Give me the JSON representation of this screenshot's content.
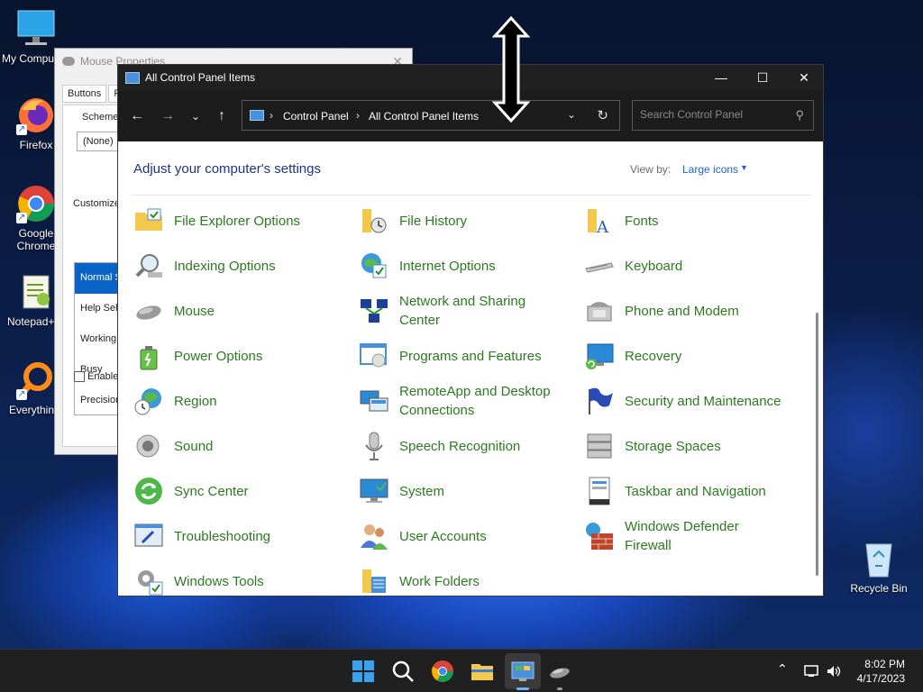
{
  "desktop": {
    "icons": [
      {
        "label": "My Computer",
        "icon": "monitor-icon"
      },
      {
        "label": "Firefox",
        "icon": "firefox-icon"
      },
      {
        "label": "Google Chrome",
        "icon": "chrome-icon"
      },
      {
        "label": "Notepad++",
        "icon": "notepad-icon"
      },
      {
        "label": "Everything",
        "icon": "everything-icon"
      },
      {
        "label": "Recycle Bin",
        "icon": "recycle-bin-icon"
      }
    ]
  },
  "mouse_properties": {
    "title": "Mouse Properties",
    "tabs": [
      "Buttons",
      "P"
    ],
    "scheme_label": "Scheme",
    "scheme_value": "(None)",
    "customize_label": "Customize",
    "cursor_list": [
      "Normal S",
      "Help Sele",
      "Working",
      "Busy",
      "Precision"
    ],
    "enable_label": "Enable"
  },
  "control_panel": {
    "title": "All Control Panel Items",
    "breadcrumb": [
      "Control Panel",
      "All Control Panel Items"
    ],
    "search_placeholder": "Search Control Panel",
    "header": "Adjust your computer's settings",
    "view_by_label": "View by:",
    "view_by_value": "Large icons",
    "items": [
      {
        "label": "File Explorer Options",
        "icon": "folder-options-icon"
      },
      {
        "label": "File History",
        "icon": "file-history-icon"
      },
      {
        "label": "Fonts",
        "icon": "fonts-icon"
      },
      {
        "label": "Indexing Options",
        "icon": "indexing-icon"
      },
      {
        "label": "Internet Options",
        "icon": "internet-options-icon"
      },
      {
        "label": "Keyboard",
        "icon": "keyboard-icon"
      },
      {
        "label": "Mouse",
        "icon": "mouse-icon"
      },
      {
        "label": "Network and Sharing Center",
        "icon": "network-icon"
      },
      {
        "label": "Phone and Modem",
        "icon": "phone-icon"
      },
      {
        "label": "Power Options",
        "icon": "power-icon"
      },
      {
        "label": "Programs and Features",
        "icon": "programs-icon"
      },
      {
        "label": "Recovery",
        "icon": "recovery-icon"
      },
      {
        "label": "Region",
        "icon": "region-icon"
      },
      {
        "label": "RemoteApp and Desktop Connections",
        "icon": "remoteapp-icon"
      },
      {
        "label": "Security and Maintenance",
        "icon": "security-flag-icon"
      },
      {
        "label": "Sound",
        "icon": "speaker-icon"
      },
      {
        "label": "Speech Recognition",
        "icon": "microphone-icon"
      },
      {
        "label": "Storage Spaces",
        "icon": "storage-icon"
      },
      {
        "label": "Sync Center",
        "icon": "sync-icon"
      },
      {
        "label": "System",
        "icon": "system-icon"
      },
      {
        "label": "Taskbar and Navigation",
        "icon": "taskbar-icon"
      },
      {
        "label": "Troubleshooting",
        "icon": "troubleshoot-icon"
      },
      {
        "label": "User Accounts",
        "icon": "users-icon"
      },
      {
        "label": "Windows Defender Firewall",
        "icon": "firewall-icon"
      },
      {
        "label": "Windows Tools",
        "icon": "tools-icon"
      },
      {
        "label": "Work Folders",
        "icon": "work-folders-icon"
      }
    ]
  },
  "taskbar": {
    "time": "8:02 PM",
    "date": "4/17/2023"
  }
}
